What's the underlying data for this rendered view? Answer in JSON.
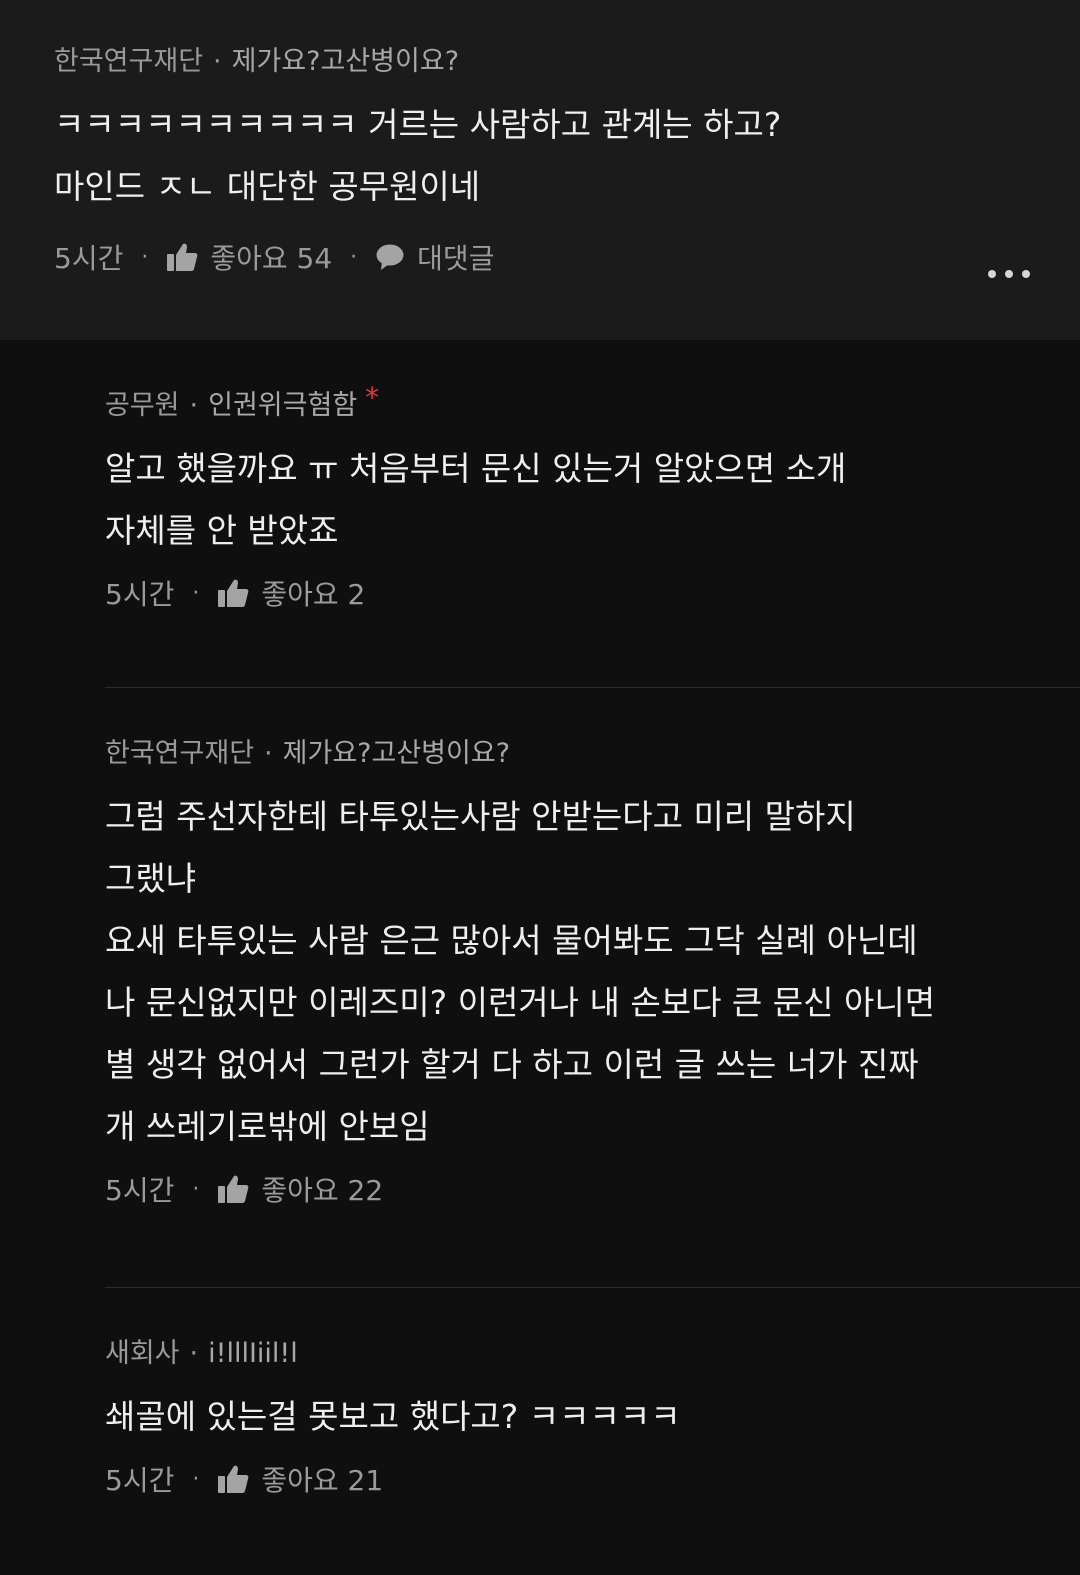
{
  "top_comment": {
    "company": "한국연구재단",
    "separator": "·",
    "nickname": "제가요?고산병이요?",
    "text": "ㅋㅋㅋㅋㅋㅋㅋㅋㅋㅋ 거르는 사람하고 관계는 하고?\n마인드 ㅈㄴ 대단한 공무원이네",
    "time": "5시간",
    "like_label": "좋아요",
    "like_count": "54",
    "reply_label": "대댓글"
  },
  "replies": [
    {
      "company": "공무원",
      "separator": "·",
      "nickname": "인권위극혐함",
      "author_mark": "*",
      "text": "알고 했을까요 ㅠ 처음부터 문신 있는거 알았으면 소개\n자체를 안 받았죠",
      "time": "5시간",
      "like_label": "좋아요",
      "like_count": "2"
    },
    {
      "company": "한국연구재단",
      "separator": "·",
      "nickname": "제가요?고산병이요?",
      "text": "그럼 주선자한테 타투있는사람 안받는다고 미리 말하지\n그랬냐\n요새 타투있는 사람 은근 많아서 물어봐도 그닥 실례 아닌데\n나 문신없지만 이레즈미? 이런거나 내 손보다 큰 문신 아니면\n별 생각 없어서 그런가 할거 다 하고 이런 글 쓰는 너가 진짜\n개 쓰레기로밖에 안보임",
      "time": "5시간",
      "like_label": "좋아요",
      "like_count": "22"
    },
    {
      "company": "새회사",
      "separator": "·",
      "nickname": "i!lllIiil!l",
      "text": "쇄골에 있는걸 못보고 했다고? ㅋㅋㅋㅋㅋ",
      "time": "5시간",
      "like_label": "좋아요",
      "like_count": "21"
    }
  ],
  "colors": {
    "background": "#0f0f0f",
    "top_comment_background": "#1b1b1b",
    "text": "#efefef",
    "meta": "#9a9a9a",
    "author_mark": "#e03a3a"
  },
  "icons": {
    "like": "thumbs-up-icon",
    "reply": "speech-bubble-icon",
    "more": "more-dots-icon"
  }
}
